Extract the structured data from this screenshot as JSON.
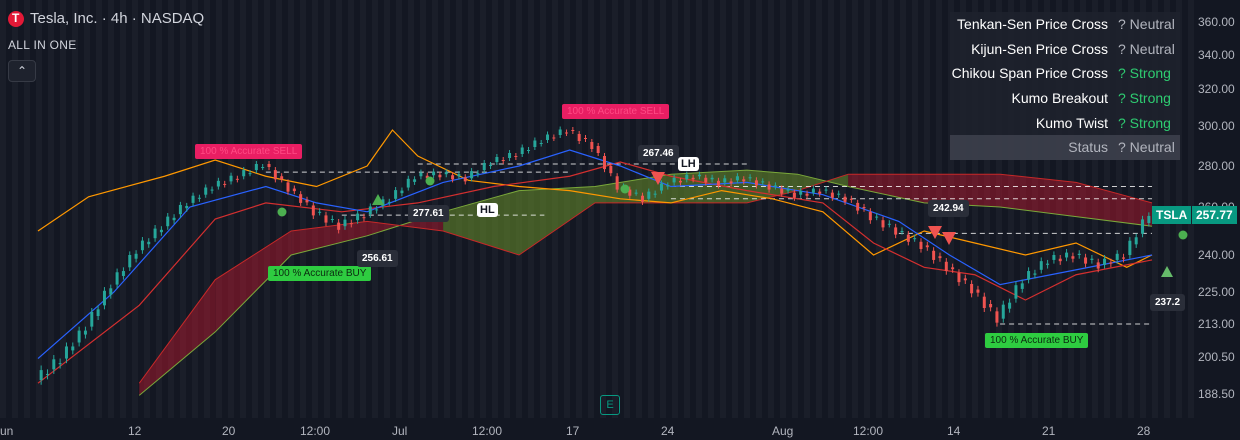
{
  "header": {
    "title": "Tesla, Inc. · 4h · NASDAQ",
    "indicator": "ALL IN ONE",
    "collapse_icon": "chevron-up-icon"
  },
  "signal_table": [
    {
      "label": "Tenkan-Sen Price Cross",
      "value": "? Neutral",
      "color": "#b2b5be"
    },
    {
      "label": "Kijun-Sen Price Cross",
      "value": "? Neutral",
      "color": "#b2b5be"
    },
    {
      "label": "Chikou Span Price Cross",
      "value": "? Strong",
      "color": "#2ecc71"
    },
    {
      "label": "Kumo Breakout",
      "value": "? Strong",
      "color": "#2ecc71"
    },
    {
      "label": "Kumo Twist",
      "value": "? Strong",
      "color": "#2ecc71"
    },
    {
      "label": "Status",
      "value": "? Neutral",
      "color": "#b2b5be"
    }
  ],
  "chart_data": {
    "type": "line",
    "symbol": "TSLA",
    "last_price": "257.77",
    "y_ticks": [
      "360.00",
      "340.00",
      "320.00",
      "300.00",
      "280.00",
      "260.00",
      "240.00",
      "225.00",
      "213.00",
      "200.50",
      "188.50"
    ],
    "x_ticks": [
      "un",
      "12",
      "20",
      "12:00",
      "Jul",
      "12:00",
      "17",
      "24",
      "Aug",
      "12:00",
      "14",
      "21",
      "28"
    ],
    "colors": {
      "bull": "#26a69a",
      "bear": "#ef5350",
      "cloud_bull": "#6a8f2a",
      "cloud_bear": "#c2182e",
      "tenkan": "#2962ff",
      "kijun": "#d32f2f",
      "chikou": "#ff9800"
    },
    "signals": [
      {
        "text": "100 % Accurate BUY",
        "kind": "buy"
      },
      {
        "text": "100 % Accurate SELL",
        "kind": "sell"
      },
      {
        "text": "100 % Accurate SELL",
        "kind": "sell"
      },
      {
        "text": "100 % Accurate BUY",
        "kind": "buy"
      }
    ],
    "price_labels": [
      "256.61",
      "277.61",
      "267.46",
      "242.94",
      "237.2"
    ],
    "structure_labels": [
      "HL",
      "LH"
    ],
    "close_series": [
      {
        "x": 0,
        "y": 193
      },
      {
        "x": 2,
        "y": 200
      },
      {
        "x": 4,
        "y": 212
      },
      {
        "x": 6,
        "y": 228
      },
      {
        "x": 8,
        "y": 242
      },
      {
        "x": 10,
        "y": 252
      },
      {
        "x": 12,
        "y": 262
      },
      {
        "x": 14,
        "y": 270
      },
      {
        "x": 16,
        "y": 275
      },
      {
        "x": 18,
        "y": 281
      },
      {
        "x": 20,
        "y": 269
      },
      {
        "x": 22,
        "y": 258
      },
      {
        "x": 24,
        "y": 252
      },
      {
        "x": 26,
        "y": 257
      },
      {
        "x": 28,
        "y": 264
      },
      {
        "x": 30,
        "y": 275
      },
      {
        "x": 32,
        "y": 276
      },
      {
        "x": 34,
        "y": 274
      },
      {
        "x": 36,
        "y": 282
      },
      {
        "x": 38,
        "y": 286
      },
      {
        "x": 40,
        "y": 293
      },
      {
        "x": 42,
        "y": 298
      },
      {
        "x": 44,
        "y": 290
      },
      {
        "x": 46,
        "y": 270
      },
      {
        "x": 48,
        "y": 264
      },
      {
        "x": 50,
        "y": 272
      },
      {
        "x": 52,
        "y": 275
      },
      {
        "x": 54,
        "y": 272
      },
      {
        "x": 56,
        "y": 274
      },
      {
        "x": 58,
        "y": 270
      },
      {
        "x": 60,
        "y": 266
      },
      {
        "x": 62,
        "y": 268
      },
      {
        "x": 64,
        "y": 264
      },
      {
        "x": 66,
        "y": 256
      },
      {
        "x": 68,
        "y": 250
      },
      {
        "x": 70,
        "y": 244
      },
      {
        "x": 72,
        "y": 235
      },
      {
        "x": 74,
        "y": 226
      },
      {
        "x": 76,
        "y": 215
      },
      {
        "x": 78,
        "y": 230
      },
      {
        "x": 80,
        "y": 238
      },
      {
        "x": 82,
        "y": 240
      },
      {
        "x": 84,
        "y": 236
      },
      {
        "x": 86,
        "y": 240
      },
      {
        "x": 88,
        "y": 257.77
      }
    ],
    "tenkan": [
      {
        "x": 0,
        "y": 200
      },
      {
        "x": 6,
        "y": 225
      },
      {
        "x": 12,
        "y": 260
      },
      {
        "x": 18,
        "y": 270
      },
      {
        "x": 22,
        "y": 262
      },
      {
        "x": 26,
        "y": 258
      },
      {
        "x": 32,
        "y": 272
      },
      {
        "x": 38,
        "y": 280
      },
      {
        "x": 42,
        "y": 288
      },
      {
        "x": 46,
        "y": 280
      },
      {
        "x": 50,
        "y": 270
      },
      {
        "x": 56,
        "y": 272
      },
      {
        "x": 62,
        "y": 266
      },
      {
        "x": 68,
        "y": 254
      },
      {
        "x": 72,
        "y": 240
      },
      {
        "x": 76,
        "y": 228
      },
      {
        "x": 80,
        "y": 232
      },
      {
        "x": 84,
        "y": 236
      },
      {
        "x": 88,
        "y": 240
      }
    ],
    "kijun": [
      {
        "x": 0,
        "y": 192
      },
      {
        "x": 8,
        "y": 220
      },
      {
        "x": 14,
        "y": 255
      },
      {
        "x": 18,
        "y": 262
      },
      {
        "x": 24,
        "y": 258
      },
      {
        "x": 30,
        "y": 262
      },
      {
        "x": 36,
        "y": 270
      },
      {
        "x": 42,
        "y": 275
      },
      {
        "x": 46,
        "y": 282
      },
      {
        "x": 50,
        "y": 275
      },
      {
        "x": 56,
        "y": 268
      },
      {
        "x": 62,
        "y": 262
      },
      {
        "x": 66,
        "y": 245
      },
      {
        "x": 70,
        "y": 235
      },
      {
        "x": 74,
        "y": 232
      },
      {
        "x": 78,
        "y": 222
      },
      {
        "x": 82,
        "y": 232
      },
      {
        "x": 88,
        "y": 238
      }
    ],
    "chikou": [
      {
        "x": 0,
        "y": 250
      },
      {
        "x": 4,
        "y": 265
      },
      {
        "x": 10,
        "y": 275
      },
      {
        "x": 14,
        "y": 283
      },
      {
        "x": 18,
        "y": 275
      },
      {
        "x": 22,
        "y": 270
      },
      {
        "x": 26,
        "y": 280
      },
      {
        "x": 28,
        "y": 298
      },
      {
        "x": 30,
        "y": 285
      },
      {
        "x": 34,
        "y": 273
      },
      {
        "x": 38,
        "y": 270
      },
      {
        "x": 42,
        "y": 268
      },
      {
        "x": 46,
        "y": 264
      },
      {
        "x": 50,
        "y": 262
      },
      {
        "x": 54,
        "y": 268
      },
      {
        "x": 58,
        "y": 264
      },
      {
        "x": 62,
        "y": 258
      },
      {
        "x": 66,
        "y": 240
      },
      {
        "x": 70,
        "y": 250
      },
      {
        "x": 74,
        "y": 245
      },
      {
        "x": 78,
        "y": 240
      },
      {
        "x": 82,
        "y": 245
      },
      {
        "x": 86,
        "y": 235
      },
      {
        "x": 88,
        "y": 240
      }
    ],
    "cloud_a": [
      {
        "x": 8,
        "y": 188
      },
      {
        "x": 14,
        "y": 210
      },
      {
        "x": 20,
        "y": 240
      },
      {
        "x": 26,
        "y": 248
      },
      {
        "x": 32,
        "y": 258
      },
      {
        "x": 38,
        "y": 268
      },
      {
        "x": 44,
        "y": 270
      },
      {
        "x": 50,
        "y": 276
      },
      {
        "x": 56,
        "y": 278
      },
      {
        "x": 60,
        "y": 276
      },
      {
        "x": 64,
        "y": 270
      },
      {
        "x": 70,
        "y": 262
      },
      {
        "x": 76,
        "y": 260
      },
      {
        "x": 82,
        "y": 256
      },
      {
        "x": 88,
        "y": 252
      }
    ],
    "cloud_b": [
      {
        "x": 8,
        "y": 192
      },
      {
        "x": 14,
        "y": 230
      },
      {
        "x": 20,
        "y": 250
      },
      {
        "x": 26,
        "y": 254
      },
      {
        "x": 32,
        "y": 250
      },
      {
        "x": 38,
        "y": 240
      },
      {
        "x": 44,
        "y": 262
      },
      {
        "x": 50,
        "y": 262
      },
      {
        "x": 56,
        "y": 262
      },
      {
        "x": 60,
        "y": 268
      },
      {
        "x": 64,
        "y": 276
      },
      {
        "x": 70,
        "y": 276
      },
      {
        "x": 76,
        "y": 276
      },
      {
        "x": 82,
        "y": 272
      },
      {
        "x": 88,
        "y": 262
      }
    ],
    "h_levels": [
      {
        "y": 277,
        "from": 18,
        "to": 42
      },
      {
        "y": 281,
        "from": 30,
        "to": 56
      },
      {
        "y": 270,
        "from": 50,
        "to": 88
      },
      {
        "y": 256.61,
        "from": 24,
        "to": 40
      },
      {
        "y": 264,
        "from": 50,
        "to": 88
      },
      {
        "y": 213,
        "from": 76,
        "to": 88
      },
      {
        "y": 249,
        "from": 68,
        "to": 88
      }
    ],
    "ylim": [
      180,
      365
    ],
    "xlim": [
      -3,
      91
    ]
  }
}
